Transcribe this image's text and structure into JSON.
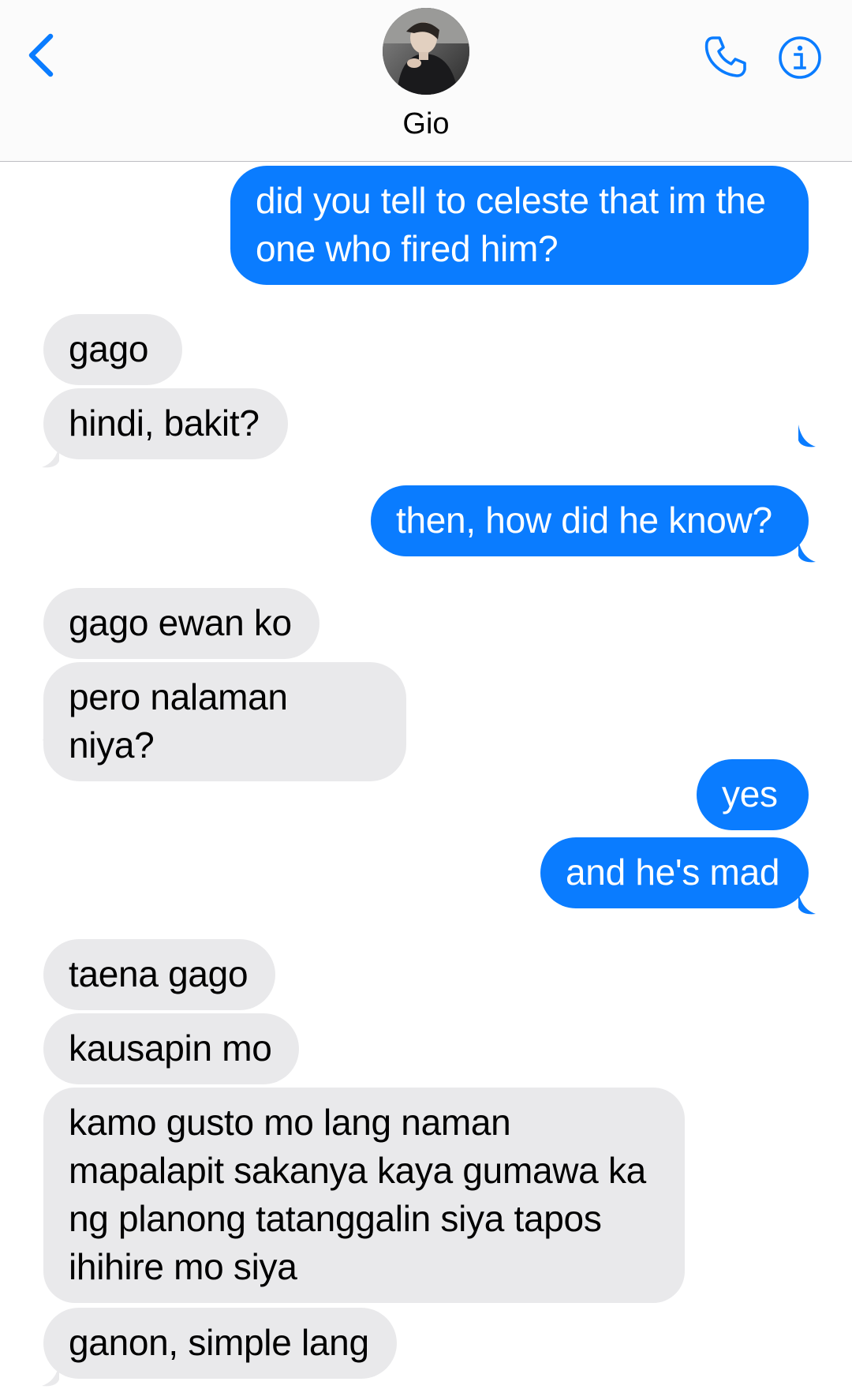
{
  "header": {
    "contact_name": "Gio",
    "back_icon": "chevron-left-icon",
    "call_icon": "phone-icon",
    "info_icon": "info-icon",
    "accent_color": "#0a7cff"
  },
  "messages": [
    {
      "from": "me",
      "text": "did you tell to celeste that im the one who fired him?"
    },
    {
      "from": "them",
      "text": "gago"
    },
    {
      "from": "them",
      "text": "hindi, bakit?"
    },
    {
      "from": "me",
      "text": "then, how did he know?"
    },
    {
      "from": "them",
      "text": "gago ewan ko"
    },
    {
      "from": "them",
      "text": "pero nalaman niya?"
    },
    {
      "from": "me",
      "text": "yes"
    },
    {
      "from": "me",
      "text": "and he's mad"
    },
    {
      "from": "them",
      "text": "taena gago"
    },
    {
      "from": "them",
      "text": "kausapin mo"
    },
    {
      "from": "them",
      "text": "kamo gusto mo lang naman mapalapit sakanya kaya gumawa ka ng planong tatanggalin siya tapos ihihire mo siya"
    },
    {
      "from": "them",
      "text": "ganon, simple lang"
    }
  ],
  "colors": {
    "sent_bubble": "#0a7cff",
    "received_bubble": "#e9e9eb"
  }
}
